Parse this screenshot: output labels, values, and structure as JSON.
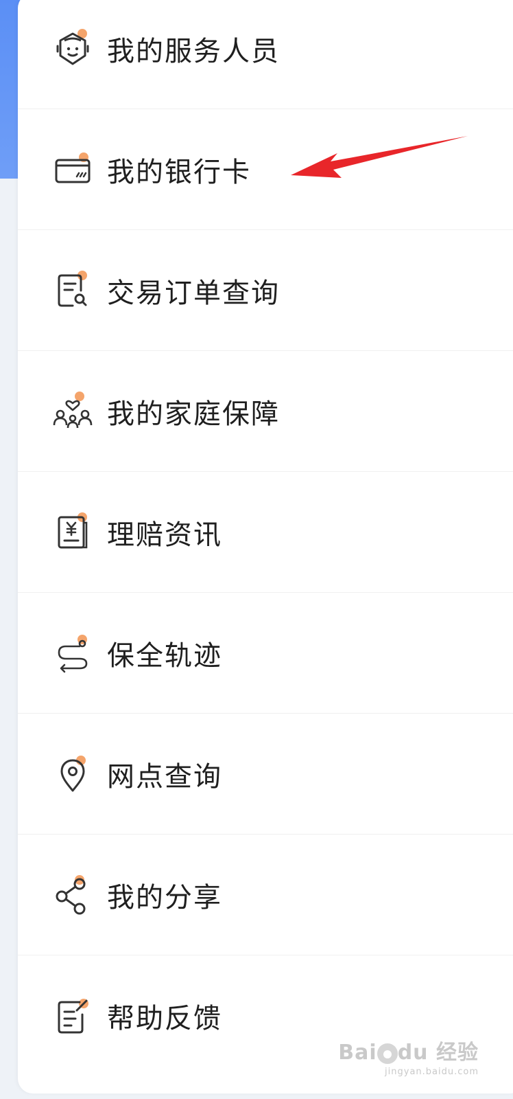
{
  "menu": {
    "items": [
      {
        "label": "我的服务人员",
        "icon": "service-person-icon"
      },
      {
        "label": "我的银行卡",
        "icon": "bank-card-icon"
      },
      {
        "label": "交易订单查询",
        "icon": "order-search-icon"
      },
      {
        "label": "我的家庭保障",
        "icon": "family-protection-icon"
      },
      {
        "label": "理赔资讯",
        "icon": "claim-document-icon"
      },
      {
        "label": "保全轨迹",
        "icon": "route-track-icon"
      },
      {
        "label": "网点查询",
        "icon": "location-pin-icon"
      },
      {
        "label": "我的分享",
        "icon": "share-icon"
      },
      {
        "label": "帮助反馈",
        "icon": "feedback-edit-icon"
      }
    ]
  },
  "colors": {
    "accent_dot": "#f39a5b",
    "icon_stroke": "#333333",
    "arrow": "#e8262a",
    "sidebar_blue": "#6a9bf6"
  },
  "watermark": {
    "main": "Bai",
    "main2": "du",
    "brand": "经验",
    "url": "jingyan.baidu.com"
  }
}
